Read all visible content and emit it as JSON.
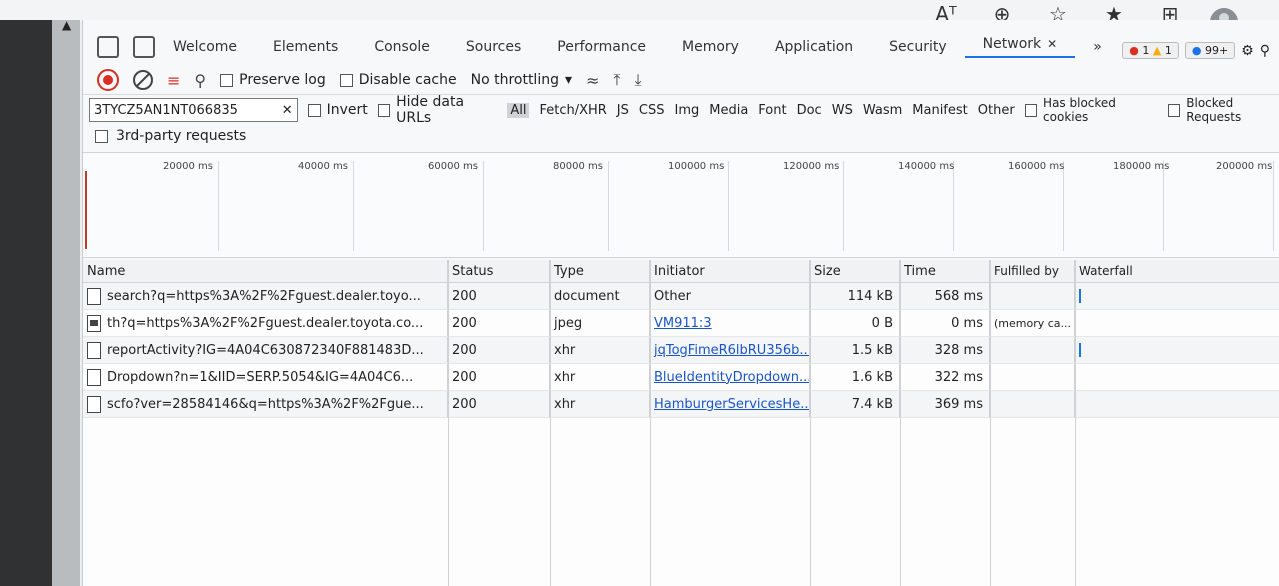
{
  "browser": {
    "icons": [
      "read-aloud-icon",
      "zoom-icon",
      "favorite-add-icon",
      "favorites-icon",
      "collections-icon",
      "profile-avatar"
    ]
  },
  "tabs": [
    {
      "label": "Welcome"
    },
    {
      "label": "Elements"
    },
    {
      "label": "Console"
    },
    {
      "label": "Sources"
    },
    {
      "label": "Performance"
    },
    {
      "label": "Memory"
    },
    {
      "label": "Application"
    },
    {
      "label": "Security"
    },
    {
      "label": "Network",
      "active": true
    }
  ],
  "counters": {
    "errors": "1",
    "warnings": "1",
    "info": "99+"
  },
  "toolbar": {
    "preserve_log": "Preserve log",
    "disable_cache": "Disable cache",
    "throttling": "No throttling"
  },
  "filter": {
    "value": "3TYCZ5AN1NT066835",
    "invert": "Invert",
    "hide_data_urls": "Hide data URLs",
    "types": [
      "All",
      "Fetch/XHR",
      "JS",
      "CSS",
      "Img",
      "Media",
      "Font",
      "Doc",
      "WS",
      "Wasm",
      "Manifest",
      "Other"
    ],
    "has_blocked_cookies": "Has blocked cookies",
    "blocked_requests": "Blocked Requests",
    "third_party": "3rd-party requests"
  },
  "overview_ticks": [
    "20000 ms",
    "40000 ms",
    "60000 ms",
    "80000 ms",
    "100000 ms",
    "120000 ms",
    "140000 ms",
    "160000 ms",
    "180000 ms",
    "200000 ms"
  ],
  "table": {
    "headers": [
      "Name",
      "Status",
      "Type",
      "Initiator",
      "Size",
      "Time",
      "Fulfilled by",
      "Waterfall"
    ],
    "rows": [
      {
        "name": "search?q=https%3A%2F%2Fguest.dealer.toyo...",
        "status": "200",
        "type": "document",
        "initiator": "Other",
        "initiator_link": false,
        "size": "114 kB",
        "time": "568 ms",
        "fulfilled": "",
        "icon": "document-icon"
      },
      {
        "name": "th?q=https%3A%2F%2Fguest.dealer.toyota.co...",
        "status": "200",
        "type": "jpeg",
        "initiator": "VM911:3",
        "initiator_link": true,
        "size": "0 B",
        "time": "0 ms",
        "fulfilled": "(memory ca...",
        "icon": "image-icon"
      },
      {
        "name": "reportActivity?IG=4A04C630872340F881483D...",
        "status": "200",
        "type": "xhr",
        "initiator": "jqTogFimeR6lbRU356b...",
        "initiator_link": true,
        "size": "1.5 kB",
        "time": "328 ms",
        "fulfilled": "",
        "icon": "document-icon"
      },
      {
        "name": "Dropdown?n=1&IID=SERP.5054&IG=4A04C6...",
        "status": "200",
        "type": "xhr",
        "initiator": "BlueIdentityDropdown...",
        "initiator_link": true,
        "size": "1.6 kB",
        "time": "322 ms",
        "fulfilled": "",
        "icon": "document-icon"
      },
      {
        "name": "scfo?ver=28584146&q=https%3A%2F%2Fgue...",
        "status": "200",
        "type": "xhr",
        "initiator": "HamburgerServicesHe...",
        "initiator_link": true,
        "size": "7.4 kB",
        "time": "369 ms",
        "fulfilled": "",
        "icon": "document-icon"
      }
    ]
  }
}
